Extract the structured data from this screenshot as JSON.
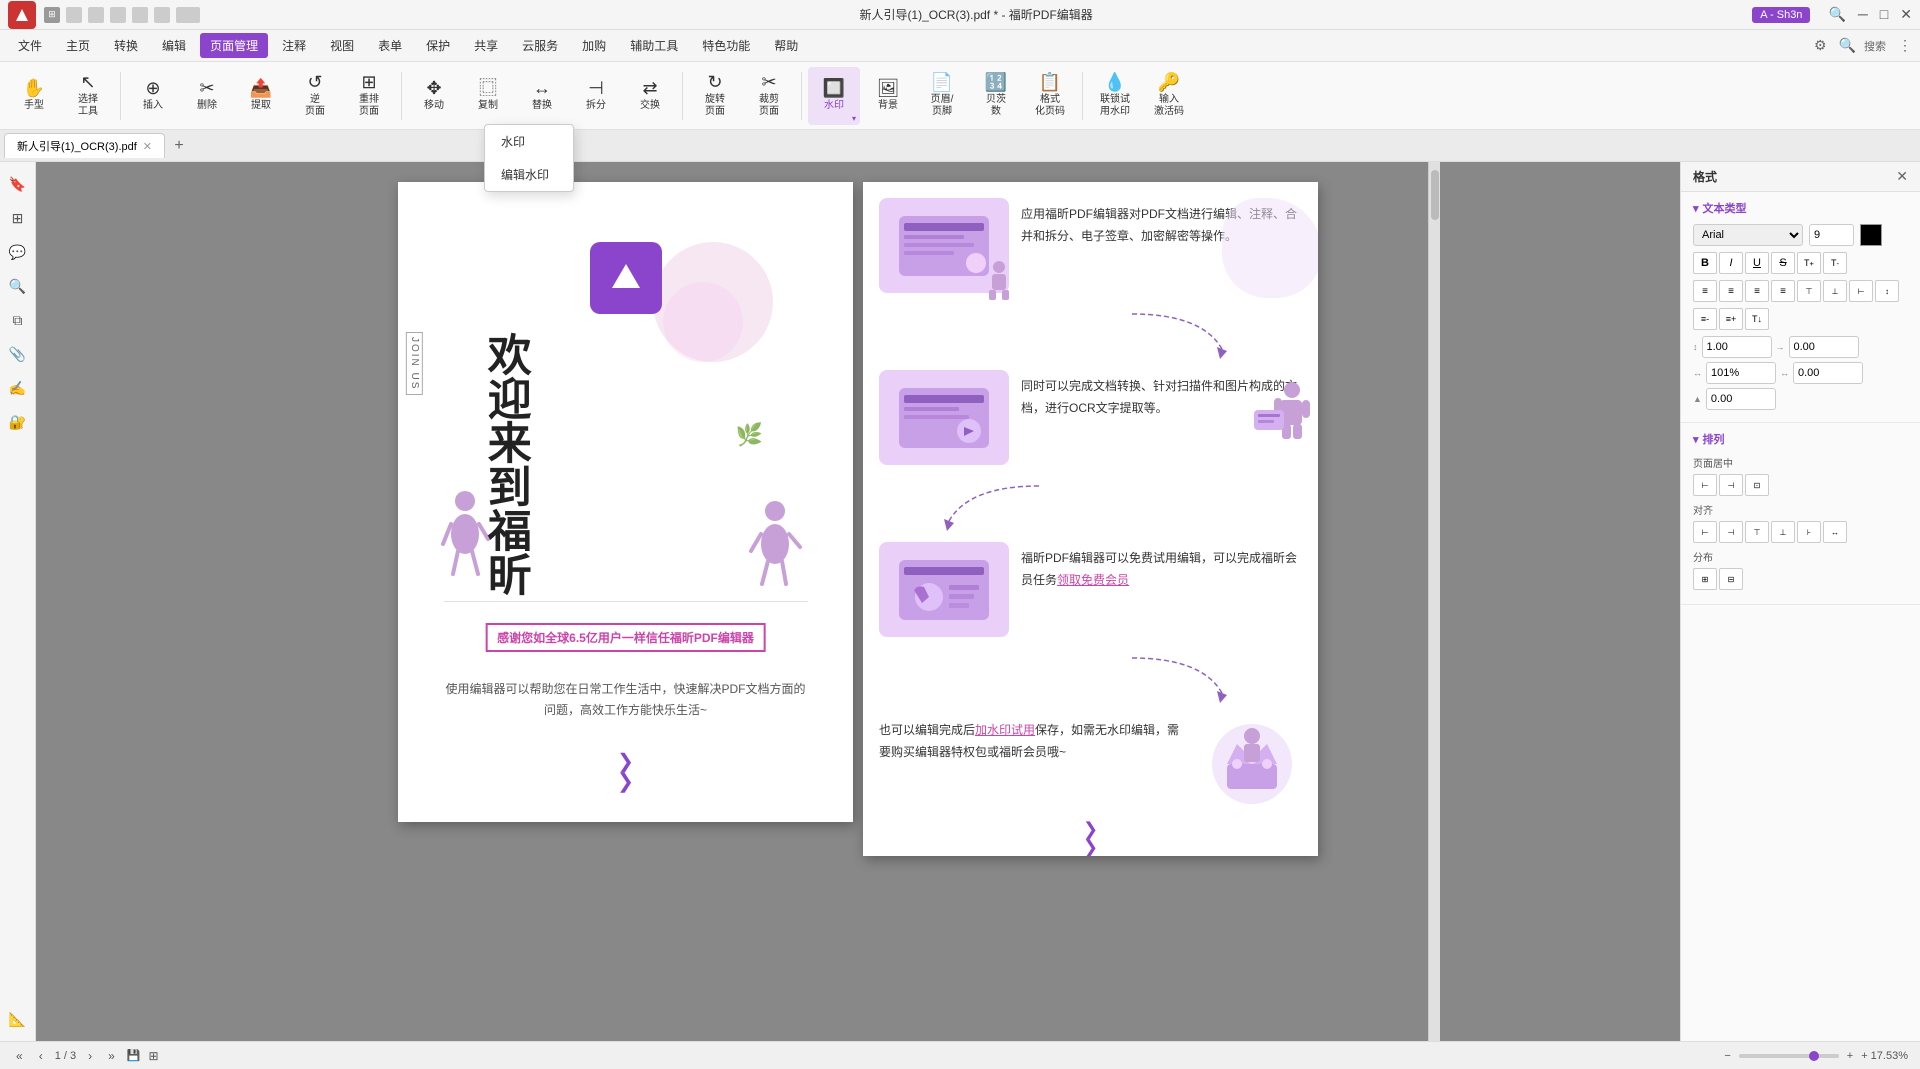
{
  "titlebar": {
    "title": "新人引导(1)_OCR(3).pdf * - 福昕PDF编辑器",
    "user_badge": "A - Sh3n",
    "logo_text": "F"
  },
  "menubar": {
    "items": [
      "文件",
      "主页",
      "转换",
      "编辑",
      "页面管理",
      "注释",
      "视图",
      "表单",
      "保护",
      "共享",
      "云服务",
      "加购",
      "辅助工具",
      "特色功能",
      "帮助"
    ]
  },
  "toolbar": {
    "items": [
      {
        "label": "手型",
        "icon": "✋"
      },
      {
        "label": "选择\n工具",
        "icon": "↖"
      },
      {
        "label": "插入",
        "icon": "⊕"
      },
      {
        "label": "删除",
        "icon": "✂"
      },
      {
        "label": "提取",
        "icon": "📤"
      },
      {
        "label": "逆\n页面",
        "icon": "↺"
      },
      {
        "label": "重排\n页面",
        "icon": "⊞"
      },
      {
        "label": "移动",
        "icon": "✥"
      },
      {
        "label": "复制",
        "icon": "⿴"
      },
      {
        "label": "替换",
        "icon": "↔"
      },
      {
        "label": "拆分",
        "icon": "⊣"
      },
      {
        "label": "交换",
        "icon": "⇄"
      },
      {
        "label": "旋转\n页面",
        "icon": "↻"
      },
      {
        "label": "裁剪\n页面",
        "icon": "✂"
      },
      {
        "label": "水印",
        "icon": "🔲",
        "active": true
      },
      {
        "label": "背景",
        "icon": "🖼"
      },
      {
        "label": "页眉/\n页脚",
        "icon": "📄"
      },
      {
        "label": "贝茨\n数",
        "icon": "🔢"
      },
      {
        "label": "格式\n化页码",
        "icon": "📋"
      },
      {
        "label": "联锁试\n用水印",
        "icon": "💧"
      },
      {
        "label": "输入\n激活码",
        "icon": "🔑"
      }
    ],
    "watermark_dropdown": {
      "item1": "水印",
      "item2": "编辑水印"
    }
  },
  "tabs": {
    "active_tab": "新人引导(1)_OCR(3).pdf"
  },
  "page1": {
    "welcome": "欢迎来到福昕",
    "join_us": "JOIN US",
    "tagline": "感谢您如全球6.5亿用户一样信任福昕PDF编辑器",
    "desc1": "使用编辑器可以帮助您在日常工作生活中，快速解决PDF文档方面的",
    "desc2": "问题，高效工作方能快乐生活~"
  },
  "page2": {
    "section1_text": "应用福昕PDF编辑器对PDF文档进行编辑、注释、合并和拆分、电子签章、加密解密等操作。",
    "section2_text": "同时可以完成文档转换、针对扫描件和图片构成的文档，进行OCR文字提取等。",
    "section3_text_pre": "福昕PDF编辑器可以免费试用编辑，可以完成福昕会员任务",
    "section3_link": "领取免费会员",
    "section4_text_pre": "也可以编辑完成后",
    "section4_link": "加水印试用",
    "section4_text_post": "保存，如需无水印编辑，需要购买编辑器特权包或福昕会员哦~"
  },
  "right_panel": {
    "title": "格式",
    "text_type_section": "文本类型",
    "font_name": "Arial",
    "font_size": "9",
    "color": "black",
    "format_buttons": [
      "B",
      "I",
      "U",
      "S",
      "T",
      "T"
    ],
    "align_buttons": [
      "≡",
      "≡",
      "≡",
      "≡",
      "≡",
      "≡",
      "≡",
      "≡"
    ],
    "list_buttons": [
      "≡-",
      "≡+",
      "T-"
    ],
    "spacing_values": [
      "1.00",
      "0.00",
      "101%",
      "0.00",
      "0.00"
    ],
    "paragraph_section": "排列",
    "page_center_label": "页面居中",
    "align_label": "对齐",
    "distribute_label": "分布"
  },
  "statusbar": {
    "page_info": "1 / 3",
    "zoom": "+ 17.53%",
    "nav_first": "«",
    "nav_prev": "‹",
    "nav_next": "›",
    "nav_last": "»"
  }
}
